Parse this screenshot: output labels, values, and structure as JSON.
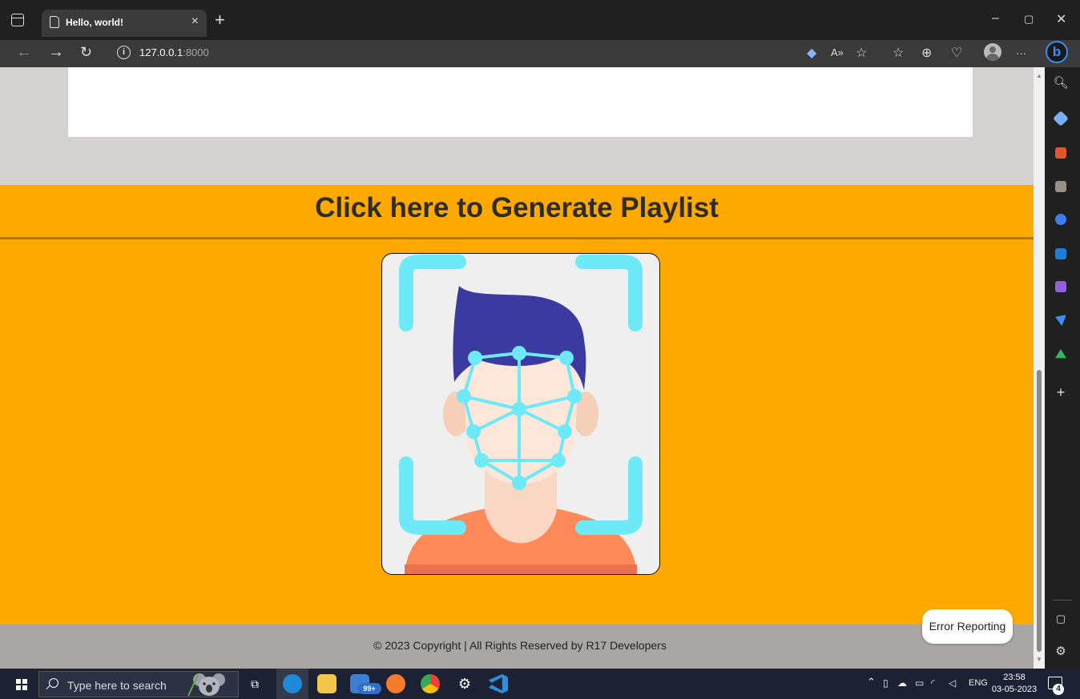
{
  "browser": {
    "tab_title": "Hello, world!",
    "tab_close": "×",
    "new_tab": "+",
    "url_host": "127.0.0.1",
    "url_port": ":8000",
    "more": "···",
    "minimize": "–",
    "restore": "▢",
    "close": "✕"
  },
  "page": {
    "title": "Click here to Generate Playlist",
    "footer": "© 2023 Copyright | All Rights Reserved by R17 Developers",
    "error_button": "Error Reporting"
  },
  "taskbar": {
    "search_placeholder": "Type here to search",
    "badge": "99+",
    "language": "ENG",
    "time": "23:58",
    "date": "03-05-2023",
    "notifications": "4"
  },
  "colors": {
    "hero_background": "#fda900",
    "page_background": "#d6d1d1",
    "footer_background": "#a9a6a6",
    "face_scan_lines": "#6de9f8",
    "hair": "#3b3aa0",
    "shirt": "#fd8a58"
  }
}
